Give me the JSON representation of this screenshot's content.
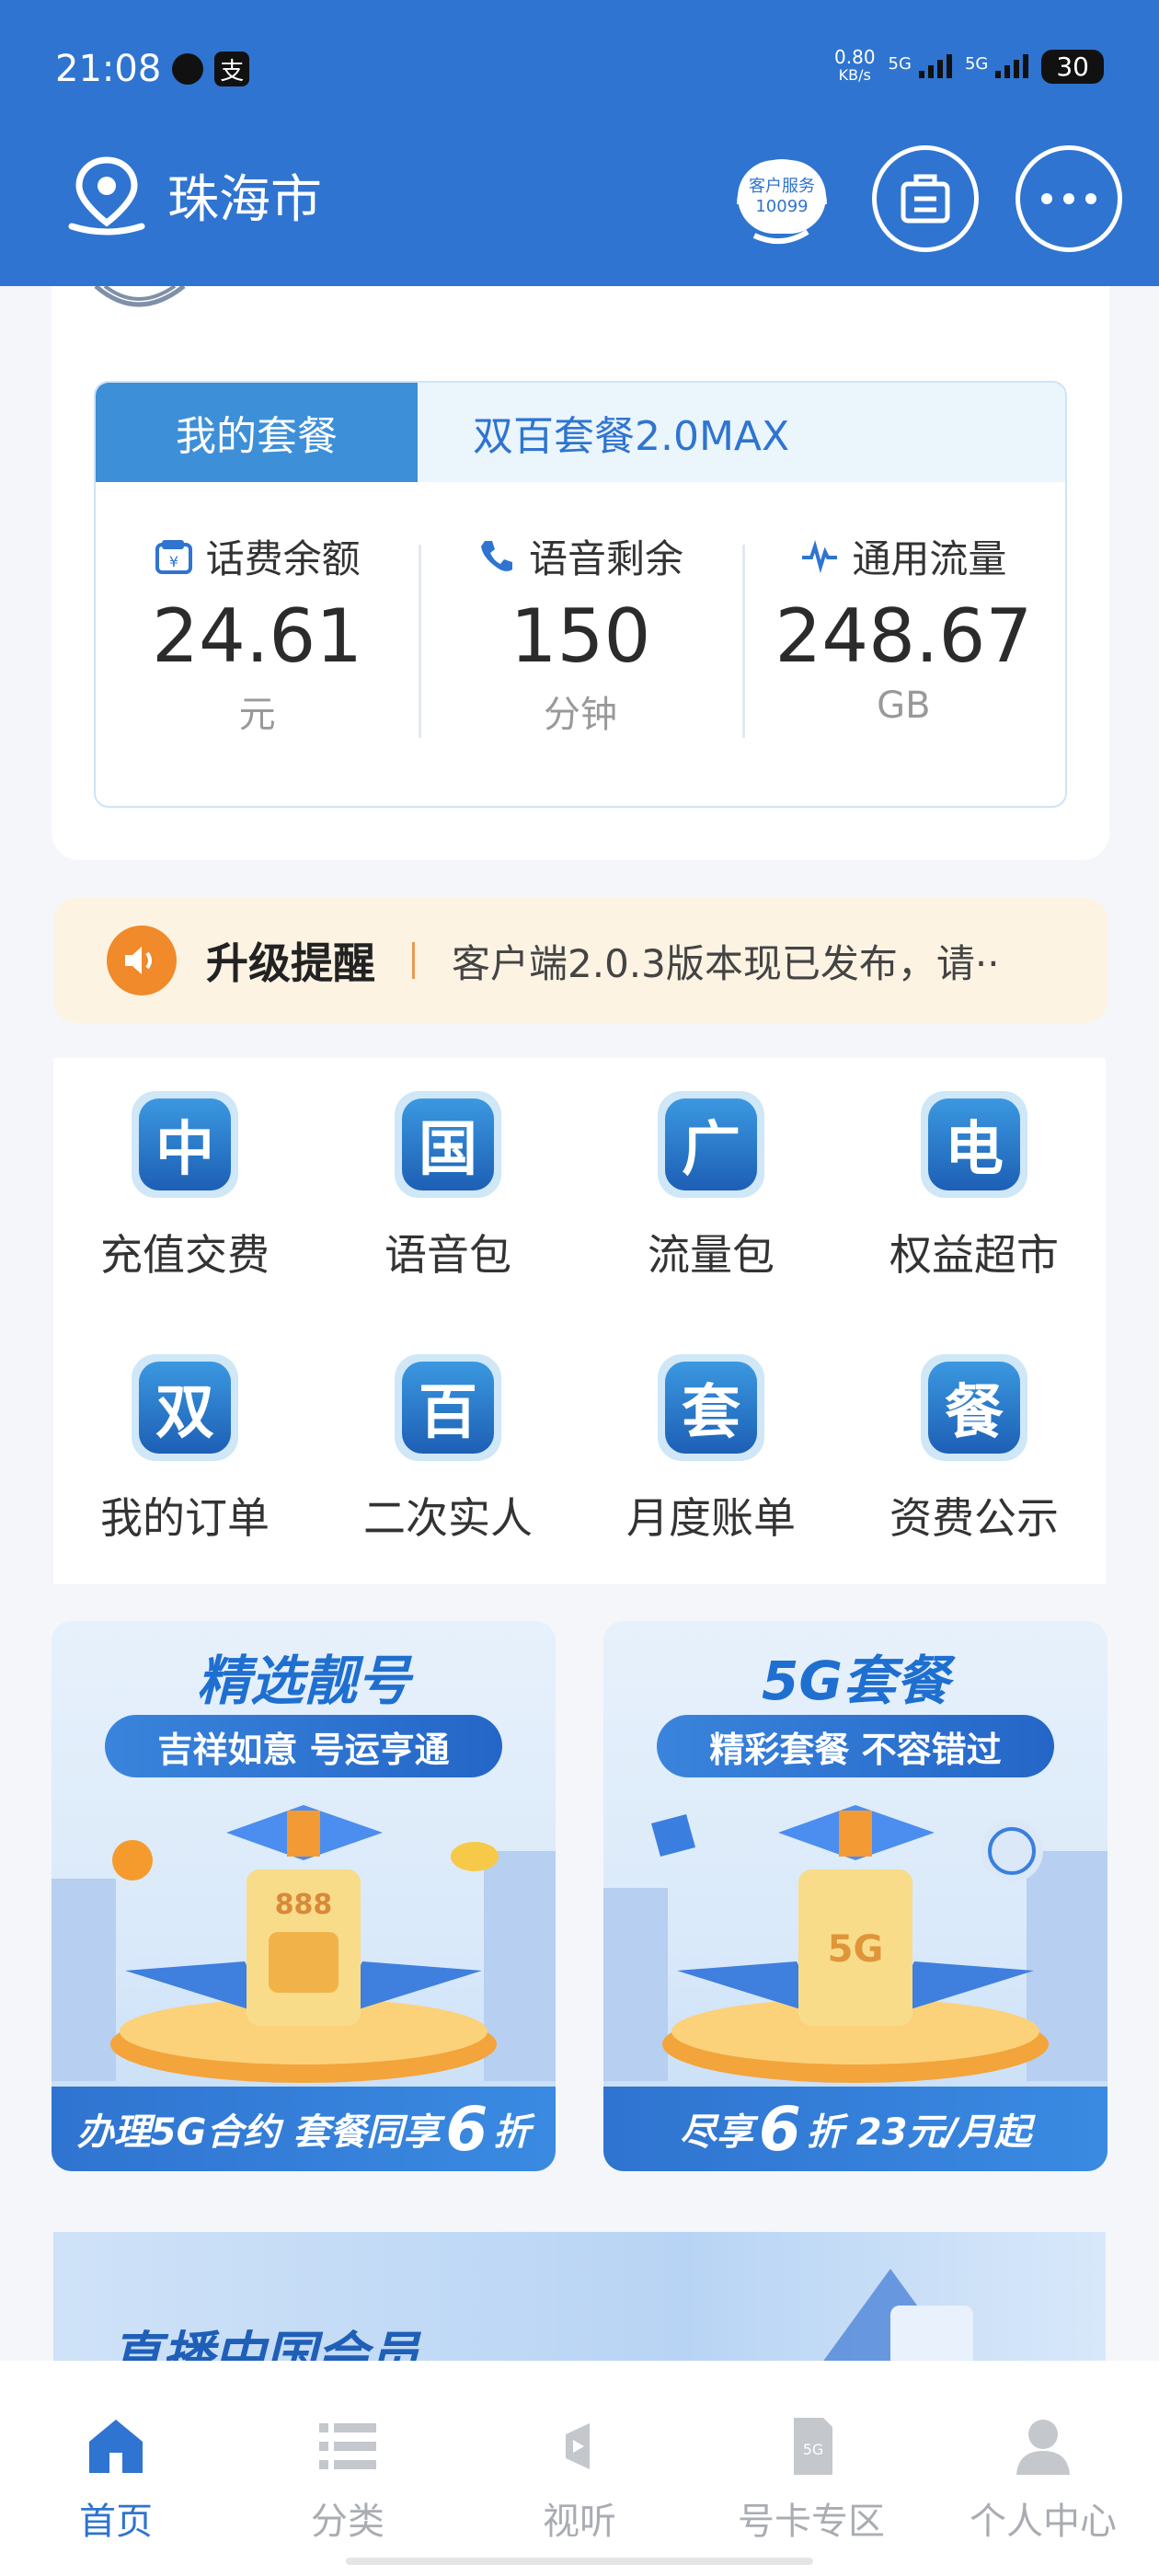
{
  "status_bar": {
    "time": "21:08",
    "speed_value": "0.80",
    "speed_unit": "KB/s",
    "network1": "5G",
    "network2": "5G",
    "battery": "30"
  },
  "header": {
    "city": "珠海市",
    "service_line1": "客户服务",
    "service_line2": "10099"
  },
  "plan": {
    "tab_label": "我的套餐",
    "plan_name": "双百套餐2.0MAX",
    "stats": [
      {
        "label": "话费余额",
        "value": "24.61",
        "unit": "元",
        "icon": "wallet-icon"
      },
      {
        "label": "语音剩余",
        "value": "150",
        "unit": "分钟",
        "icon": "phone-icon"
      },
      {
        "label": "通用流量",
        "value": "248.67",
        "unit": "GB",
        "icon": "pulse-icon"
      }
    ]
  },
  "notice": {
    "title": "升级提醒",
    "message": "客户端2.0.3版本现已发布，请··"
  },
  "services": [
    {
      "icon_char": "中",
      "label": "充值交费"
    },
    {
      "icon_char": "国",
      "label": "语音包"
    },
    {
      "icon_char": "广",
      "label": "流量包"
    },
    {
      "icon_char": "电",
      "label": "权益超市"
    },
    {
      "icon_char": "双",
      "label": "我的订单"
    },
    {
      "icon_char": "百",
      "label": "二次实人"
    },
    {
      "icon_char": "套",
      "label": "月度账单"
    },
    {
      "icon_char": "餐",
      "label": "资费公示"
    }
  ],
  "banners": [
    {
      "title": "精选靓号",
      "subtitle": "吉祥如意 号运亨通",
      "bottom_pre": "办理5G合约 套餐同享",
      "bottom_big": "6",
      "bottom_post": "折",
      "card_text": "888"
    },
    {
      "title": "5G套餐",
      "subtitle": "精彩套餐 不容错过",
      "bottom_pre": "尽享",
      "bottom_big": "6",
      "bottom_post": "折 23元/月起",
      "card_text": "5G"
    }
  ],
  "banner3": {
    "title": "直播中国会员"
  },
  "tabs": [
    {
      "label": "首页",
      "icon": "home-icon",
      "active": true
    },
    {
      "label": "分类",
      "icon": "list-icon",
      "active": false
    },
    {
      "label": "视听",
      "icon": "media-icon",
      "active": false
    },
    {
      "label": "号卡专区",
      "icon": "sim-card-icon",
      "active": false
    },
    {
      "label": "个人中心",
      "icon": "person-icon",
      "active": false
    }
  ],
  "colors": {
    "primary": "#2f74d0",
    "notice_bg": "#fdf3e3",
    "speaker": "#f08a2a"
  }
}
